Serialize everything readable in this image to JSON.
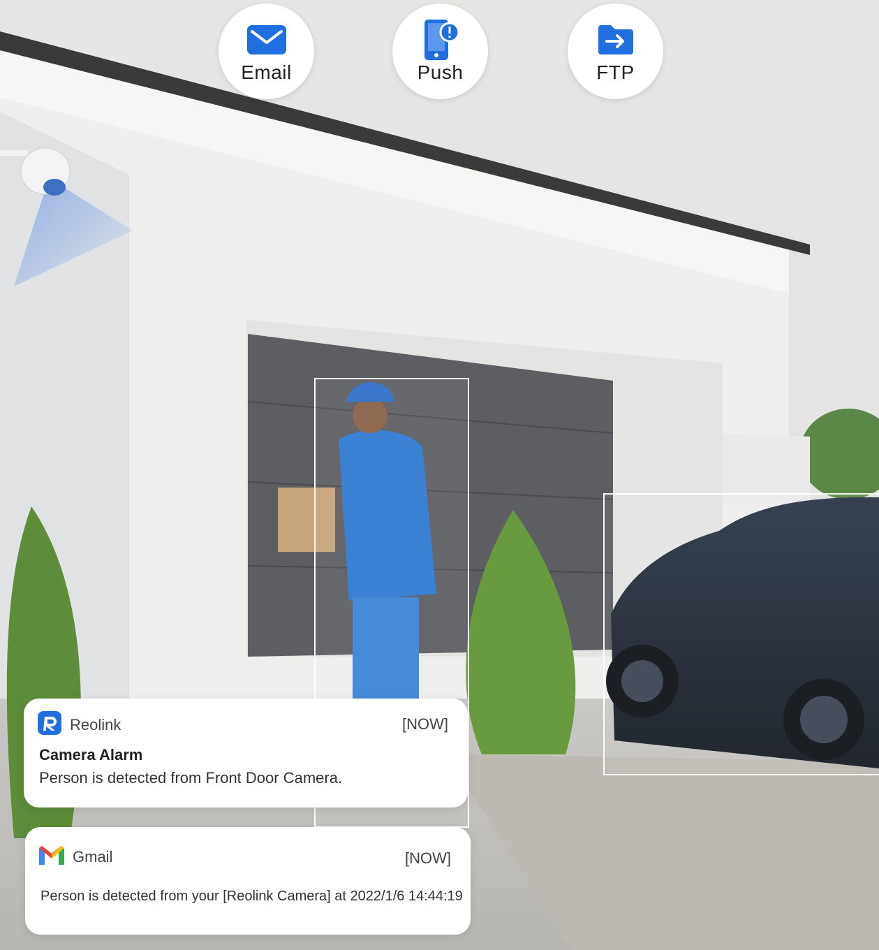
{
  "alerts": [
    {
      "label": "Email",
      "icon": "email-icon"
    },
    {
      "label": "Push",
      "icon": "push-notification-icon"
    },
    {
      "label": "FTP",
      "icon": "ftp-folder-icon"
    }
  ],
  "notifications": {
    "reolink": {
      "app_name": "Reolink",
      "time": "[NOW]",
      "title": "Camera Alarm",
      "message": "Person is detected from Front Door Camera."
    },
    "gmail": {
      "app_name": "Gmail",
      "time": "[NOW]",
      "message": "Person is detected from your [Reolink Camera] at 2022/1/6 14:44:19"
    }
  },
  "colors": {
    "accent_blue": "#1f6fe0",
    "gmail_red": "#ea4335",
    "gmail_blue": "#4285f4",
    "gmail_green": "#34a853",
    "gmail_yellow": "#fbbc04"
  }
}
